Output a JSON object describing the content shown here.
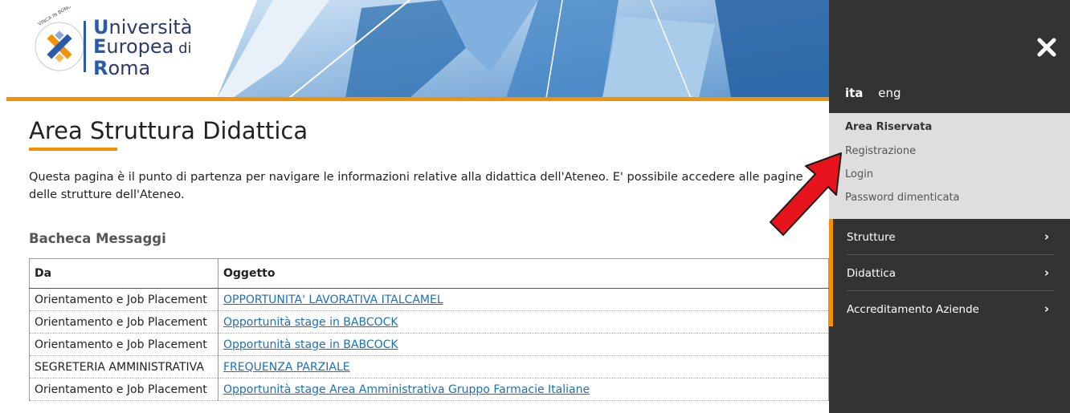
{
  "header": {
    "logo": {
      "emblem_text": "VINCA IN BONO MALUM",
      "line1_cap": "U",
      "line1_rest": "niversità",
      "line2_cap": "E",
      "line2_rest": "uropea",
      "line2_suffix": " di",
      "line3_cap": "R",
      "line3_rest": "oma"
    }
  },
  "main": {
    "title": "Area Struttura Didattica",
    "intro": "Questa pagina è il punto di partenza per navigare le informazioni relative alla didattica dell'Ateneo. E' possibile accedere alle pagine delle strutture dell'Ateneo.",
    "section_title": "Bacheca Messaggi",
    "table": {
      "headers": [
        "Da",
        "Oggetto"
      ],
      "rows": [
        {
          "da": "Orientamento e Job Placement",
          "oggetto": "OPPORTUNITA' LAVORATIVA ITALCAMEL"
        },
        {
          "da": "Orientamento e Job Placement",
          "oggetto": "Opportunità stage in BABCOCK"
        },
        {
          "da": "Orientamento e Job Placement",
          "oggetto": "Opportunità stage in BABCOCK"
        },
        {
          "da": "SEGRETERIA AMMINISTRATIVA",
          "oggetto": "FREQUENZA PARZIALE"
        },
        {
          "da": "Orientamento e Job Placement",
          "oggetto": "Opportunità stage Area Amministrativa Gruppo Farmacie Italiane"
        }
      ]
    }
  },
  "panel": {
    "close_icon": "close-icon",
    "languages": {
      "ita": "ita",
      "eng": "eng"
    },
    "reserved": {
      "title": "Area Riservata",
      "links": [
        "Registrazione",
        "Login",
        "Password dimenticata"
      ]
    },
    "nav": [
      {
        "label": "Strutture",
        "chevron": "›"
      },
      {
        "label": "Didattica",
        "chevron": "›"
      },
      {
        "label": "Accreditamento Aziende",
        "chevron": "›"
      }
    ]
  },
  "colors": {
    "accent_orange": "#f39200",
    "panel_dark": "#333333",
    "panel_light": "#dedede",
    "link_blue": "#1f6fb7",
    "logo_blue": "#2a5aa8",
    "arrow_red": "#e8141b"
  }
}
